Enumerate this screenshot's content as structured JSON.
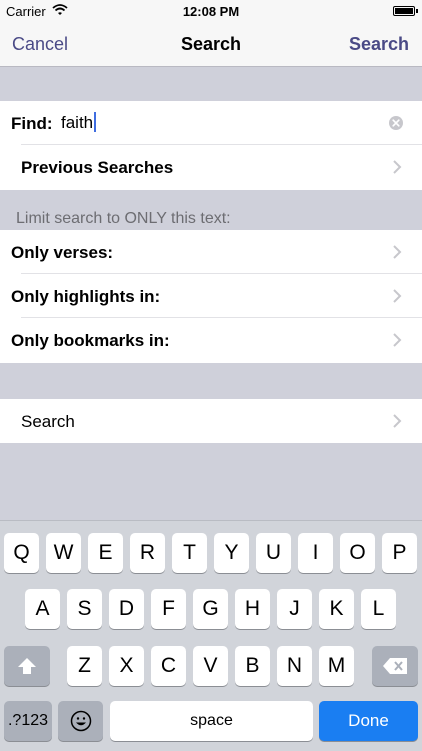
{
  "status": {
    "carrier": "Carrier",
    "time": "12:08 PM"
  },
  "nav": {
    "cancel": "Cancel",
    "title": "Search",
    "search": "Search"
  },
  "find": {
    "label": "Find:",
    "value": "faith"
  },
  "previous_searches": "Previous Searches",
  "limit_header": "Limit search to ONLY this text:",
  "filters": [
    "Only verses:",
    "Only highlights in:",
    "Only bookmarks in:"
  ],
  "search_row": "Search",
  "keyboard": {
    "row1": [
      "Q",
      "W",
      "E",
      "R",
      "T",
      "Y",
      "U",
      "I",
      "O",
      "P"
    ],
    "row2": [
      "A",
      "S",
      "D",
      "F",
      "G",
      "H",
      "J",
      "K",
      "L"
    ],
    "row3": [
      "Z",
      "X",
      "C",
      "V",
      "B",
      "N",
      "M"
    ],
    "numbers": ".?123",
    "space": "space",
    "done": "Done",
    "shift_icon": "shift-icon",
    "delete_icon": "delete-icon",
    "emoji_icon": "emoji-icon"
  },
  "colors": {
    "accent": "#4a4a86",
    "done_blue": "#1a7ef2"
  }
}
